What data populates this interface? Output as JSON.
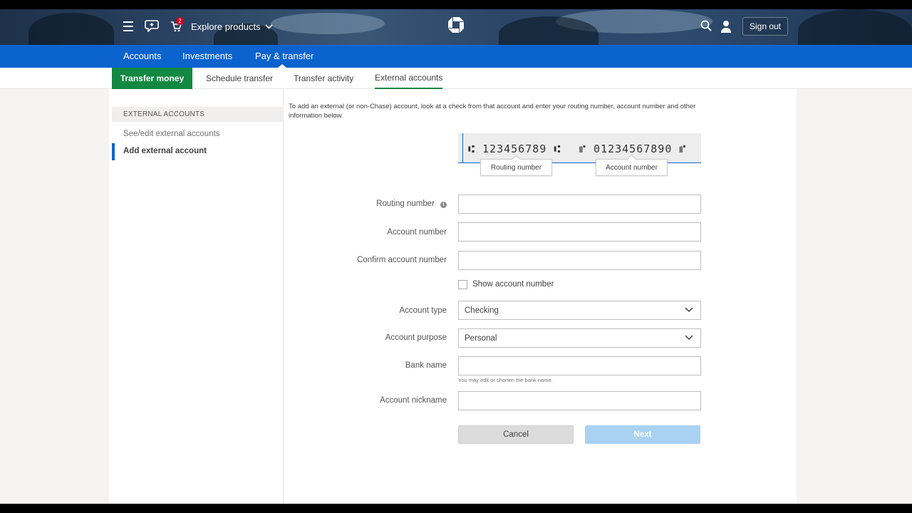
{
  "header": {
    "explore_label": "Explore products",
    "cart_badge": "2",
    "signout_label": "Sign out"
  },
  "main_nav": {
    "items": [
      {
        "label": "Accounts"
      },
      {
        "label": "Investments"
      },
      {
        "label": "Pay & transfer"
      }
    ],
    "active_index": 2
  },
  "sub_nav": {
    "tabs": [
      {
        "label": "Transfer money"
      },
      {
        "label": "Schedule transfer"
      },
      {
        "label": "Transfer activity"
      },
      {
        "label": "External accounts"
      }
    ]
  },
  "sidebar": {
    "heading": "EXTERNAL ACCOUNTS",
    "items": [
      {
        "label": "See/edit external accounts"
      },
      {
        "label": "Add external account"
      }
    ]
  },
  "form": {
    "intro": "To add an external (or non-Chase) account, look at a check from that account and enter your routing number, account number and other information below.",
    "check": {
      "routing_micr": "⑆ 123456789 ⑆",
      "account_micr": "⑈ 01234567890 ⑈",
      "routing_callout": "Routing number",
      "account_callout": "Account number"
    },
    "routing_label": "Routing number",
    "routing_value": "",
    "account_label": "Account number",
    "account_value": "",
    "confirm_label": "Confirm account number",
    "confirm_value": "",
    "show_account_label": "Show account number",
    "account_type_label": "Account type",
    "account_type_value": "Checking",
    "account_purpose_label": "Account purpose",
    "account_purpose_value": "Personal",
    "bank_name_label": "Bank name",
    "bank_name_value": "",
    "bank_name_hint": "You may edit or shorten the bank name.",
    "nickname_label": "Account nickname",
    "nickname_value": "",
    "cancel_label": "Cancel",
    "next_label": "Next"
  },
  "colors": {
    "brand_blue": "#0b63ce",
    "active_green": "#128842",
    "next_disabled": "#a9d2f2"
  }
}
